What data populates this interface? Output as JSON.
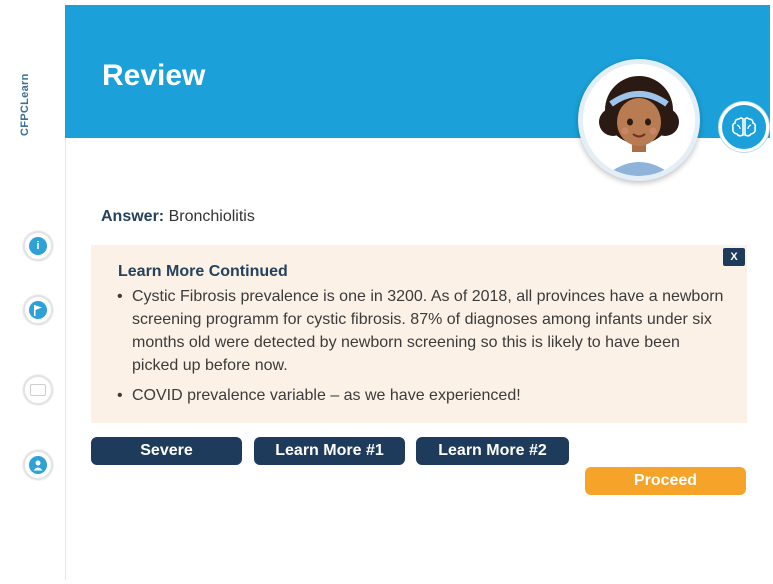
{
  "brand": {
    "name": "CFPCLearn"
  },
  "header": {
    "title": "Review"
  },
  "answer": {
    "label": "Answer:",
    "value": "Bronchiolitis"
  },
  "learn_more": {
    "title": "Learn More Continued",
    "close_label": "X",
    "bullets": [
      "Cystic Fibrosis prevalence is one in 3200.  As of 2018, all provinces have a newborn screening programm for cystic fibrosis. 87% of diagnoses among infants under six months old were detected by newborn screening so this is likely to have been picked up before now.",
      "COVID prevalence variable – as we have experienced!"
    ]
  },
  "buttons": {
    "severe": "Severe",
    "learn_more_1": "Learn More #1",
    "learn_more_2": "Learn More #2",
    "proceed": "Proceed"
  },
  "rail_icons": {
    "info_glyph": "i"
  },
  "colors": {
    "header_blue": "#1ba0d9",
    "navy": "#1f3b5c",
    "orange": "#f6a429",
    "panel_bg": "#fbf1e6"
  },
  "icons": [
    "info-icon",
    "flag-icon",
    "note-icon",
    "user-icon",
    "brain-icon",
    "child-avatar"
  ]
}
